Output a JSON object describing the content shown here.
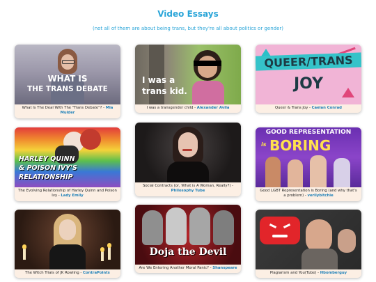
{
  "header": {
    "title": "Video Essays",
    "subtitle": "(not all of them are about being trans, but they're all about politics or gender)"
  },
  "cards": [
    {
      "thumb_text": [
        "WHAT IS",
        "THE TRANS DEBATE"
      ],
      "title": "What Is The Deal With The \"Trans Debate\"? - ",
      "author": "Mia Mulder"
    },
    {
      "thumb_text": [
        "I was a",
        "trans kid."
      ],
      "title": "I was a transgender child - ",
      "author": "Alexander Avila"
    },
    {
      "thumb_text": [
        "QUEER/TRANS",
        "JOY"
      ],
      "title": "Queer & Trans Joy - ",
      "author": "Caelan Conrad"
    },
    {
      "thumb_text": [
        "HARLEY QUINN",
        "& POISON IVY'S",
        "RELATIONSHIP"
      ],
      "title": "The Evolving Relationship of Harley Quinn and Poison Ivy - ",
      "author": "Lady Emily"
    },
    {
      "thumb_text": [],
      "title": "Social Contracts (or, What is A Woman, Really?) - ",
      "author": "Philosophy Tube"
    },
    {
      "thumb_text": [
        "GOOD REPRESENTATION",
        "is",
        "BORING"
      ],
      "title": "Good LGBT Representation is Boring (and why that's a problem) - ",
      "author": "verilybitchie"
    },
    {
      "thumb_text": [],
      "title": "The Witch Trials of JK Rowling - ",
      "author": "ContraPoints"
    },
    {
      "thumb_text": [
        "Doja the Devil"
      ],
      "title": "Are We Entering Another Moral Panic? - ",
      "author": "Shanspeare"
    },
    {
      "thumb_text": [],
      "title": "Plagiarism and You(Tube) - ",
      "author": "Hbomberguy"
    }
  ],
  "colors": {
    "accent": "#2aa5d8",
    "author": "#1b7fb8",
    "card_bg": "#fcefe4"
  }
}
